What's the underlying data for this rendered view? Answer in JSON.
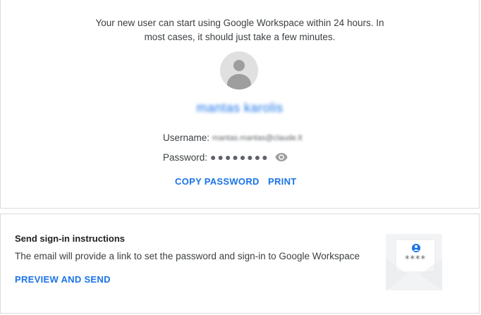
{
  "confirmation": {
    "intro_text": "Your new user can start using Google Workspace within 24 hours. In most cases, it should just take a few minutes.",
    "user_full_name": "mantas karolis",
    "username_label": "Username:",
    "username_value": "mantas.mantas@claude.lt",
    "password_label": "Password:",
    "password_mask": "●●●●●●●●",
    "copy_password_label": "COPY PASSWORD",
    "print_label": "PRINT"
  },
  "signin_card": {
    "title": "Send sign-in instructions",
    "description": "The email will provide a link to set the password and sign-in to Google Workspace",
    "preview_send_label": "PREVIEW AND SEND",
    "envelope_password_stars": "****"
  },
  "colors": {
    "accent": "#1a73e8",
    "avatar_bg": "#e0e0e0",
    "icon_gray": "#9e9e9e"
  },
  "icons": [
    "avatar-icon",
    "eye-icon",
    "envelope-icon"
  ]
}
